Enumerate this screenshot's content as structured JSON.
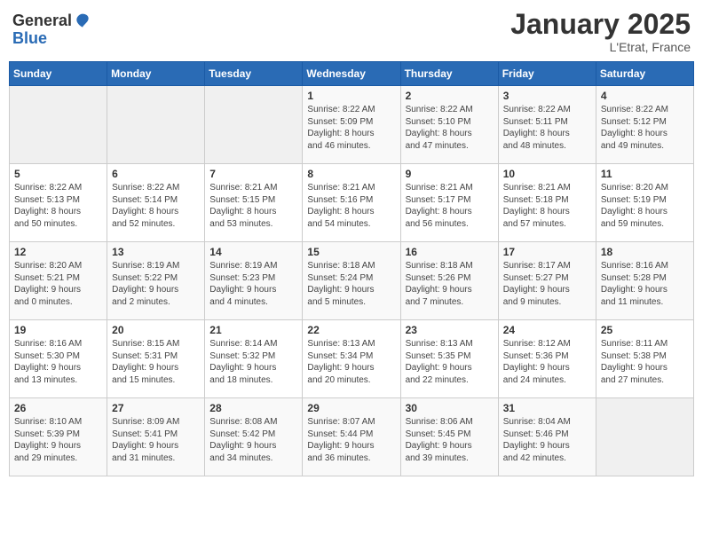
{
  "header": {
    "logo_general": "General",
    "logo_blue": "Blue",
    "month": "January 2025",
    "location": "L'Etrat, France"
  },
  "columns": [
    "Sunday",
    "Monday",
    "Tuesday",
    "Wednesday",
    "Thursday",
    "Friday",
    "Saturday"
  ],
  "weeks": [
    [
      {
        "day": "",
        "info": ""
      },
      {
        "day": "",
        "info": ""
      },
      {
        "day": "",
        "info": ""
      },
      {
        "day": "1",
        "info": "Sunrise: 8:22 AM\nSunset: 5:09 PM\nDaylight: 8 hours\nand 46 minutes."
      },
      {
        "day": "2",
        "info": "Sunrise: 8:22 AM\nSunset: 5:10 PM\nDaylight: 8 hours\nand 47 minutes."
      },
      {
        "day": "3",
        "info": "Sunrise: 8:22 AM\nSunset: 5:11 PM\nDaylight: 8 hours\nand 48 minutes."
      },
      {
        "day": "4",
        "info": "Sunrise: 8:22 AM\nSunset: 5:12 PM\nDaylight: 8 hours\nand 49 minutes."
      }
    ],
    [
      {
        "day": "5",
        "info": "Sunrise: 8:22 AM\nSunset: 5:13 PM\nDaylight: 8 hours\nand 50 minutes."
      },
      {
        "day": "6",
        "info": "Sunrise: 8:22 AM\nSunset: 5:14 PM\nDaylight: 8 hours\nand 52 minutes."
      },
      {
        "day": "7",
        "info": "Sunrise: 8:21 AM\nSunset: 5:15 PM\nDaylight: 8 hours\nand 53 minutes."
      },
      {
        "day": "8",
        "info": "Sunrise: 8:21 AM\nSunset: 5:16 PM\nDaylight: 8 hours\nand 54 minutes."
      },
      {
        "day": "9",
        "info": "Sunrise: 8:21 AM\nSunset: 5:17 PM\nDaylight: 8 hours\nand 56 minutes."
      },
      {
        "day": "10",
        "info": "Sunrise: 8:21 AM\nSunset: 5:18 PM\nDaylight: 8 hours\nand 57 minutes."
      },
      {
        "day": "11",
        "info": "Sunrise: 8:20 AM\nSunset: 5:19 PM\nDaylight: 8 hours\nand 59 minutes."
      }
    ],
    [
      {
        "day": "12",
        "info": "Sunrise: 8:20 AM\nSunset: 5:21 PM\nDaylight: 9 hours\nand 0 minutes."
      },
      {
        "day": "13",
        "info": "Sunrise: 8:19 AM\nSunset: 5:22 PM\nDaylight: 9 hours\nand 2 minutes."
      },
      {
        "day": "14",
        "info": "Sunrise: 8:19 AM\nSunset: 5:23 PM\nDaylight: 9 hours\nand 4 minutes."
      },
      {
        "day": "15",
        "info": "Sunrise: 8:18 AM\nSunset: 5:24 PM\nDaylight: 9 hours\nand 5 minutes."
      },
      {
        "day": "16",
        "info": "Sunrise: 8:18 AM\nSunset: 5:26 PM\nDaylight: 9 hours\nand 7 minutes."
      },
      {
        "day": "17",
        "info": "Sunrise: 8:17 AM\nSunset: 5:27 PM\nDaylight: 9 hours\nand 9 minutes."
      },
      {
        "day": "18",
        "info": "Sunrise: 8:16 AM\nSunset: 5:28 PM\nDaylight: 9 hours\nand 11 minutes."
      }
    ],
    [
      {
        "day": "19",
        "info": "Sunrise: 8:16 AM\nSunset: 5:30 PM\nDaylight: 9 hours\nand 13 minutes."
      },
      {
        "day": "20",
        "info": "Sunrise: 8:15 AM\nSunset: 5:31 PM\nDaylight: 9 hours\nand 15 minutes."
      },
      {
        "day": "21",
        "info": "Sunrise: 8:14 AM\nSunset: 5:32 PM\nDaylight: 9 hours\nand 18 minutes."
      },
      {
        "day": "22",
        "info": "Sunrise: 8:13 AM\nSunset: 5:34 PM\nDaylight: 9 hours\nand 20 minutes."
      },
      {
        "day": "23",
        "info": "Sunrise: 8:13 AM\nSunset: 5:35 PM\nDaylight: 9 hours\nand 22 minutes."
      },
      {
        "day": "24",
        "info": "Sunrise: 8:12 AM\nSunset: 5:36 PM\nDaylight: 9 hours\nand 24 minutes."
      },
      {
        "day": "25",
        "info": "Sunrise: 8:11 AM\nSunset: 5:38 PM\nDaylight: 9 hours\nand 27 minutes."
      }
    ],
    [
      {
        "day": "26",
        "info": "Sunrise: 8:10 AM\nSunset: 5:39 PM\nDaylight: 9 hours\nand 29 minutes."
      },
      {
        "day": "27",
        "info": "Sunrise: 8:09 AM\nSunset: 5:41 PM\nDaylight: 9 hours\nand 31 minutes."
      },
      {
        "day": "28",
        "info": "Sunrise: 8:08 AM\nSunset: 5:42 PM\nDaylight: 9 hours\nand 34 minutes."
      },
      {
        "day": "29",
        "info": "Sunrise: 8:07 AM\nSunset: 5:44 PM\nDaylight: 9 hours\nand 36 minutes."
      },
      {
        "day": "30",
        "info": "Sunrise: 8:06 AM\nSunset: 5:45 PM\nDaylight: 9 hours\nand 39 minutes."
      },
      {
        "day": "31",
        "info": "Sunrise: 8:04 AM\nSunset: 5:46 PM\nDaylight: 9 hours\nand 42 minutes."
      },
      {
        "day": "",
        "info": ""
      }
    ]
  ]
}
